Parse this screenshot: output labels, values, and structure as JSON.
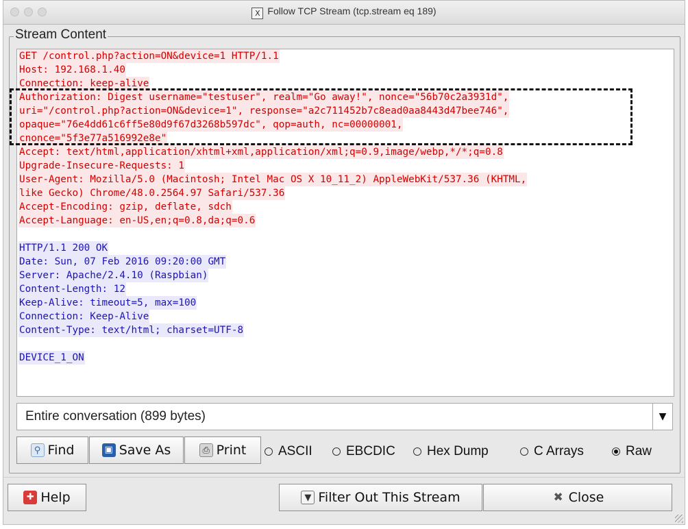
{
  "window": {
    "title": "Follow TCP Stream (tcp.stream eq 189)",
    "title_icon": "X"
  },
  "stream": {
    "legend": "Stream Content",
    "request_lines": [
      "GET /control.php?action=ON&device=1 HTTP/1.1",
      "Host: 192.168.1.40",
      "Connection: keep-alive",
      "Authorization: Digest username=\"testuser\", realm=\"Go away!\", nonce=\"56b70c2a3931d\",",
      "uri=\"/control.php?action=ON&device=1\", response=\"a2c711452b7c8ead0aa8443d47bee746\",",
      "opaque=\"76e4dd61c6ff5e80d9f67d3268b597dc\", qop=auth, nc=00000001,",
      "cnonce=\"5f3e77a516992e8e\"",
      "Accept: text/html,application/xhtml+xml,application/xml;q=0.9,image/webp,*/*;q=0.8",
      "Upgrade-Insecure-Requests: 1",
      "User-Agent: Mozilla/5.0 (Macintosh; Intel Mac OS X 10_11_2) AppleWebKit/537.36 (KHTML,",
      "like Gecko) Chrome/48.0.2564.97 Safari/537.36",
      "Accept-Encoding: gzip, deflate, sdch",
      "Accept-Language: en-US,en;q=0.8,da;q=0.6"
    ],
    "response_lines": [
      "HTTP/1.1 200 OK",
      "Date: Sun, 07 Feb 2016 09:20:00 GMT",
      "Server: Apache/2.4.10 (Raspbian)",
      "Content-Length: 12",
      "Keep-Alive: timeout=5, max=100",
      "Connection: Keep-Alive",
      "Content-Type: text/html; charset=UTF-8"
    ],
    "body_line": "DEVICE_1_ON",
    "colors": {
      "client": "#d40000",
      "client_bg": "#fbe7e8",
      "server": "#1c14b3",
      "server_bg": "#eae8fb"
    }
  },
  "conversation_select": {
    "value": "Entire conversation (899 bytes)"
  },
  "toolbar": {
    "find": {
      "label": "Find",
      "icon": "magnifier-icon"
    },
    "save_as": {
      "label": "Save As",
      "icon": "floppy-disk-icon"
    },
    "print": {
      "label": "Print",
      "icon": "printer-icon"
    }
  },
  "formats": [
    {
      "label": "ASCII",
      "selected": false
    },
    {
      "label": "EBCDIC",
      "selected": false
    },
    {
      "label": "Hex Dump",
      "selected": false
    },
    {
      "label": "C Arrays",
      "selected": false
    },
    {
      "label": "Raw",
      "selected": true
    }
  ],
  "footer": {
    "help": {
      "label": "Help",
      "icon": "lifebuoy-icon"
    },
    "filter_out": {
      "label": "Filter Out This Stream",
      "icon": "filter-icon"
    },
    "close": {
      "label": "Close",
      "icon": "close-x-icon"
    }
  }
}
